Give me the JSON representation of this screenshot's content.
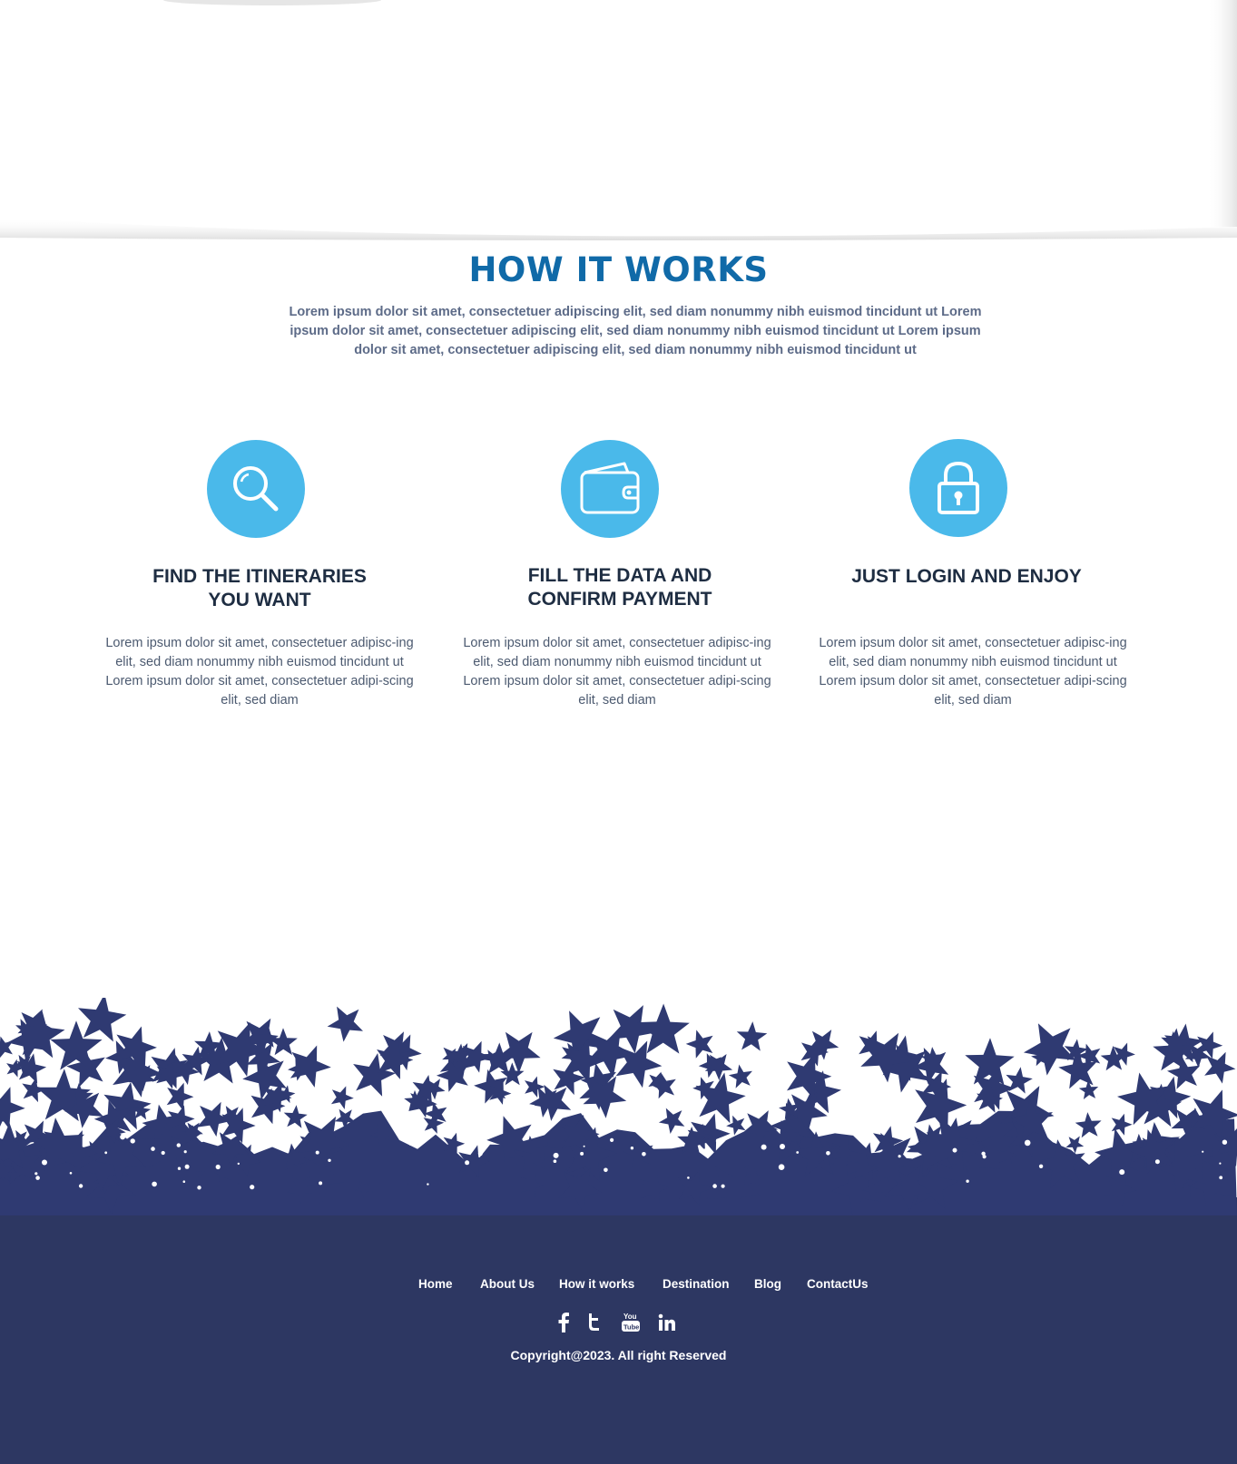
{
  "how_it_works": {
    "title": "HOW IT WORKS",
    "intro": "Lorem ipsum dolor sit amet, consectetuer adipiscing elit, sed diam nonummy nibh euismod tincidunt ut Lorem ipsum dolor sit amet, consectetuer adipiscing elit, sed diam nonummy nibh euismod tincidunt ut Lorem ipsum dolor sit amet, consectetuer adipiscing elit, sed diam nonummy nibh euismod tincidunt ut",
    "steps": [
      {
        "icon": "search-icon",
        "title_line1": "FIND THE ITINERARIES",
        "title_line2": "YOU WANT",
        "text": "Lorem ipsum dolor sit amet, consectetuer adipisc-ing elit, sed diam nonummy nibh euismod tincidunt ut Lorem ipsum dolor sit amet, consectetuer adipi-scing elit, sed diam"
      },
      {
        "icon": "wallet-icon",
        "title_line1": "FILL THE DATA AND",
        "title_line2": "CONFIRM PAYMENT",
        "text": "Lorem ipsum dolor sit amet, consectetuer adipisc-ing elit, sed diam nonummy nibh euismod tincidunt ut Lorem ipsum dolor sit amet, consectetuer adipi-scing elit, sed diam"
      },
      {
        "icon": "lock-icon",
        "title_line1": "JUST LOGIN AND ENJOY",
        "title_line2": "",
        "text": "Lorem ipsum dolor sit amet, consectetuer adipisc-ing elit, sed diam nonummy nibh euismod tincidunt ut Lorem ipsum dolor sit amet, consectetuer adipi-scing elit, sed diam"
      }
    ]
  },
  "footer": {
    "nav": [
      "Home",
      "About Us",
      "How it works",
      "Destination",
      "Blog",
      "ContactUs"
    ],
    "social": [
      "facebook-icon",
      "twitter-icon",
      "youtube-icon",
      "linkedin-icon"
    ],
    "copyright": "Copyright@2023. All right Reserved"
  },
  "colors": {
    "accent": "#4ab9ea",
    "title": "#106aa8",
    "footer": "#2d3762",
    "leaves": "#2f3a72"
  }
}
